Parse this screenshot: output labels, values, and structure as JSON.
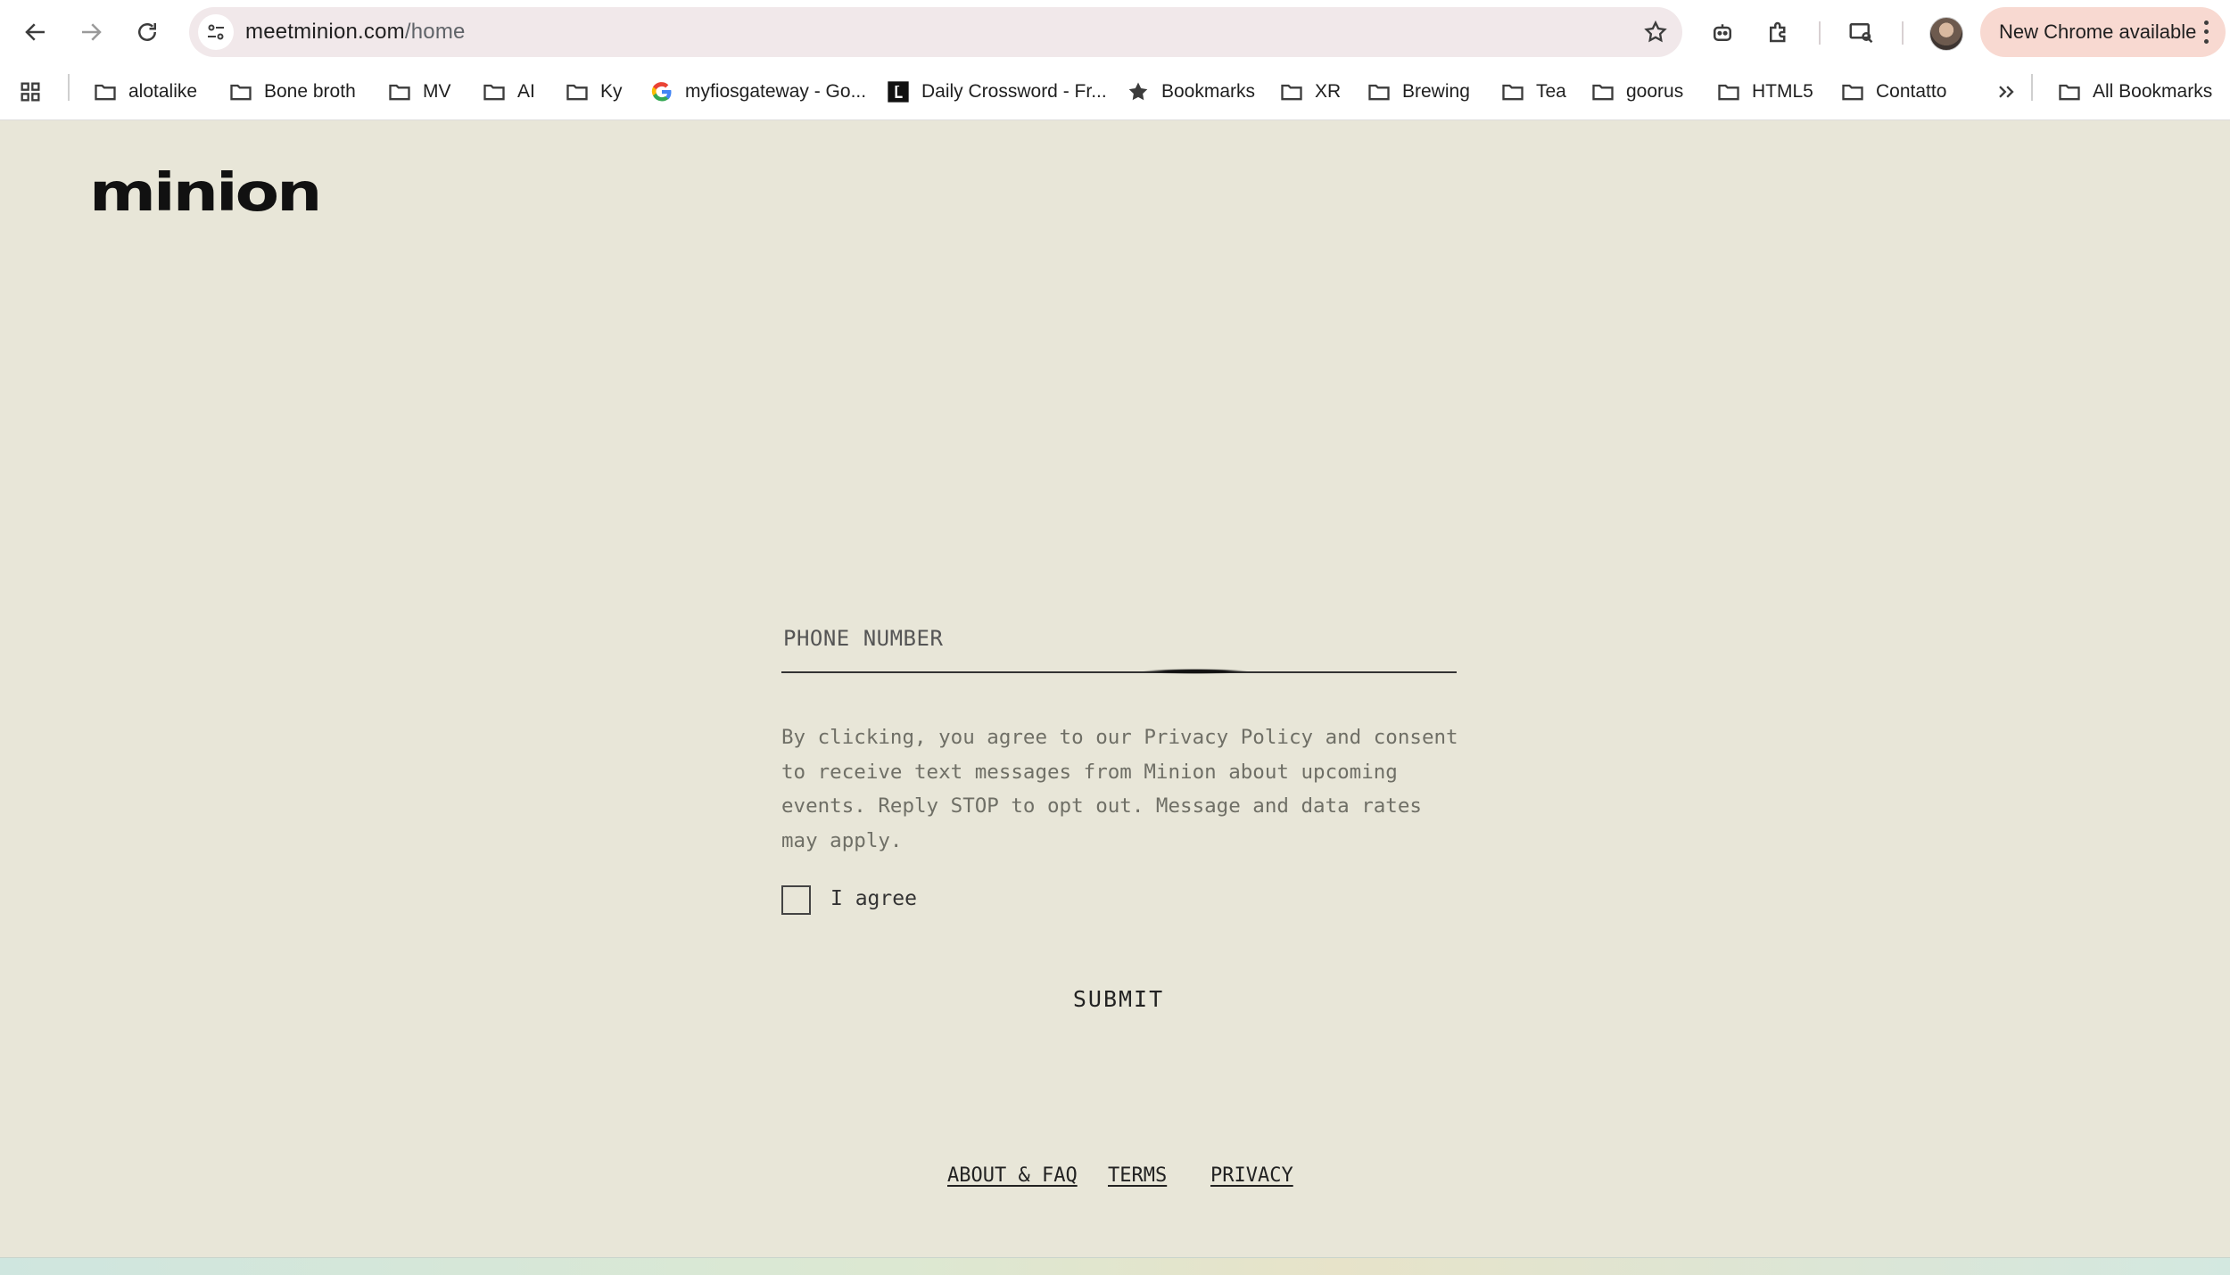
{
  "browser": {
    "url_domain": "meetminion.com",
    "url_path": "/home",
    "update_label": "New Chrome available"
  },
  "bookmarks": [
    {
      "label": "alotalike",
      "icon": "folder-icon"
    },
    {
      "label": "Bone broth",
      "icon": "folder-icon"
    },
    {
      "label": "MV",
      "icon": "folder-icon"
    },
    {
      "label": "AI",
      "icon": "folder-icon"
    },
    {
      "label": "Ky",
      "icon": "folder-icon"
    },
    {
      "label": "myfiosgateway - Go...",
      "icon": "google-icon"
    },
    {
      "label": "Daily Crossword - Fr...",
      "icon": "crossword-icon"
    },
    {
      "label": "Bookmarks",
      "icon": "star-icon"
    },
    {
      "label": "XR",
      "icon": "folder-icon"
    },
    {
      "label": "Brewing",
      "icon": "folder-icon"
    },
    {
      "label": "Tea",
      "icon": "folder-icon"
    },
    {
      "label": "goorus",
      "icon": "folder-icon"
    },
    {
      "label": "HTML5",
      "icon": "folder-icon"
    },
    {
      "label": "Contatto",
      "icon": "folder-icon"
    }
  ],
  "all_bookmarks_label": "All Bookmarks",
  "site": {
    "logo": "minion",
    "phone_placeholder": "PHONE NUMBER",
    "consent_text": "By clicking, you agree to our Privacy Policy and consent to receive text messages from Minion about upcoming events. Reply STOP to opt out. Message and data rates may apply.",
    "agree_label": "I agree",
    "submit_label": "SUBMIT",
    "footer": {
      "about": "ABOUT & FAQ",
      "terms": "TERMS",
      "privacy": "PRIVACY"
    }
  },
  "colors": {
    "page_background": "#e8e6d8",
    "update_pill": "#f8d9d1"
  }
}
